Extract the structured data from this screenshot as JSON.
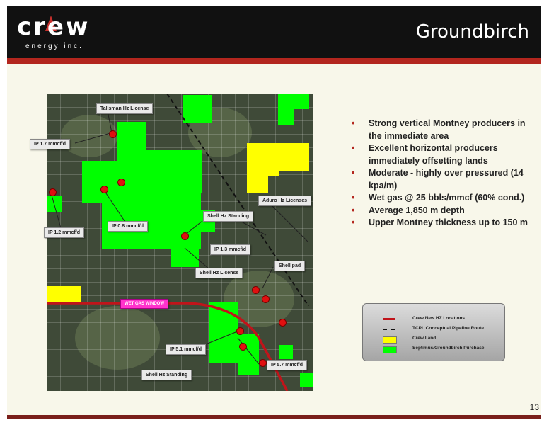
{
  "header": {
    "logo_word": "crew",
    "logo_sub": "energy inc.",
    "title": "Groundbirch"
  },
  "map": {
    "labels": {
      "talisman": "Talisman Hz License",
      "ip17": "IP 1.7 mmcf/d",
      "ip12": "IP 1.2 mmcf/d",
      "ip08": "IP 0.8 mmcf/d",
      "shell_standing_top": "Shell Hz Standing",
      "aduro": "Aduro Hz Licenses",
      "ip13": "IP 1.3 mmcf/d",
      "shell_license": "Shell Hz License",
      "shell_pad": "Shell pad",
      "wet_gas": "WET GAS WINDOW",
      "ip51": "IP 5.1 mmcf/d",
      "ip57": "IP 5.7 mmcf/d",
      "shell_standing_bottom": "Shell Hz Standing"
    }
  },
  "bullets": [
    "Strong vertical Montney producers in the immediate area",
    "Excellent horizontal producers immediately offsetting lands",
    "Moderate - highly over pressured (14 kpa/m)",
    "Wet gas @ 25 bbls/mmcf (60% cond.)",
    "Average 1,850 m depth",
    "Upper Montney thickness up to 150 m"
  ],
  "legend": {
    "items": [
      {
        "label": "Crew New HZ Locations",
        "color": "#c0141a"
      },
      {
        "label": "TCPL Conceptual Pipeline Route",
        "color": "#111111"
      },
      {
        "label": "Crew  Land",
        "color": "#ffff00"
      },
      {
        "label": "Septimus/Groundbirch Purchase",
        "color": "#00ff00"
      }
    ]
  },
  "page_number": "13"
}
